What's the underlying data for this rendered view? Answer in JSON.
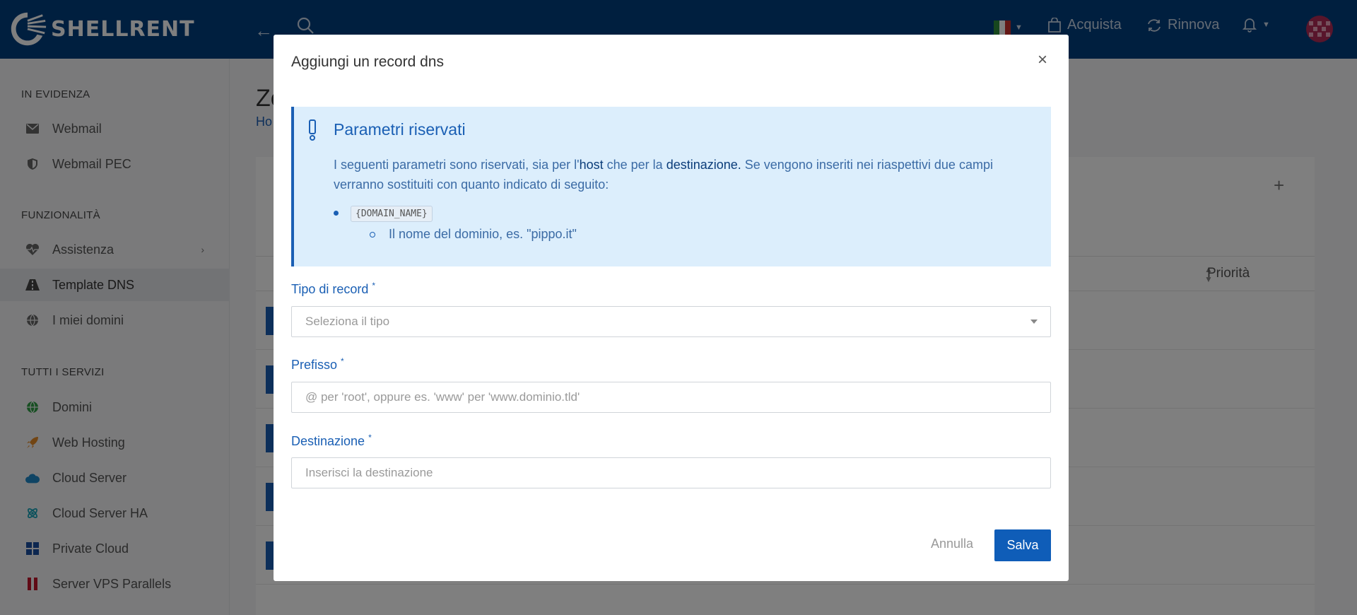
{
  "brand": {
    "name": "SHELLRENT"
  },
  "topbar": {
    "buy_label": "Acquista",
    "renew_label": "Rinnova"
  },
  "sidebar": {
    "sections": [
      {
        "title": "IN EVIDENZA"
      },
      {
        "title": "FUNZIONALITÀ"
      },
      {
        "title": "TUTTI I SERVIZI"
      }
    ],
    "items": [
      {
        "label": "Webmail"
      },
      {
        "label": "Webmail PEC"
      },
      {
        "label": "Assistenza"
      },
      {
        "label": "Template DNS"
      },
      {
        "label": "I miei domini"
      },
      {
        "label": "Domini"
      },
      {
        "label": "Web Hosting"
      },
      {
        "label": "Cloud Server"
      },
      {
        "label": "Cloud Server HA"
      },
      {
        "label": "Private Cloud"
      },
      {
        "label": "Server VPS Parallels"
      }
    ]
  },
  "main": {
    "title_partial": "Zo",
    "breadcrumb_partial": "Ho",
    "priority_header": "Priorità"
  },
  "modal": {
    "title": "Aggiungi un record dns",
    "close": "×",
    "alert": {
      "title": "Parametri riservati",
      "text_1": "I seguenti parametri sono riservati, sia per l'",
      "text_host": "host",
      "text_2": " che per la ",
      "text_dest": "destinazione.",
      "text_3": " Se vengono inseriti nei riaspettivi due campi verranno sostituiti con quanto indicato di seguito:",
      "code": "{DOMAIN_NAME}",
      "code_desc": "Il nome del dominio, es. \"pippo.it\""
    },
    "fields": {
      "record_type": {
        "label": "Tipo di record",
        "placeholder": "Seleziona il tipo"
      },
      "prefix": {
        "label": "Prefisso",
        "placeholder": "@ per 'root', oppure es. 'www' per 'www.dominio.tld'"
      },
      "destination": {
        "label": "Destinazione",
        "placeholder": "Inserisci la destinazione"
      }
    },
    "required_mark": "*",
    "cancel_label": "Annulla",
    "save_label": "Salva"
  }
}
